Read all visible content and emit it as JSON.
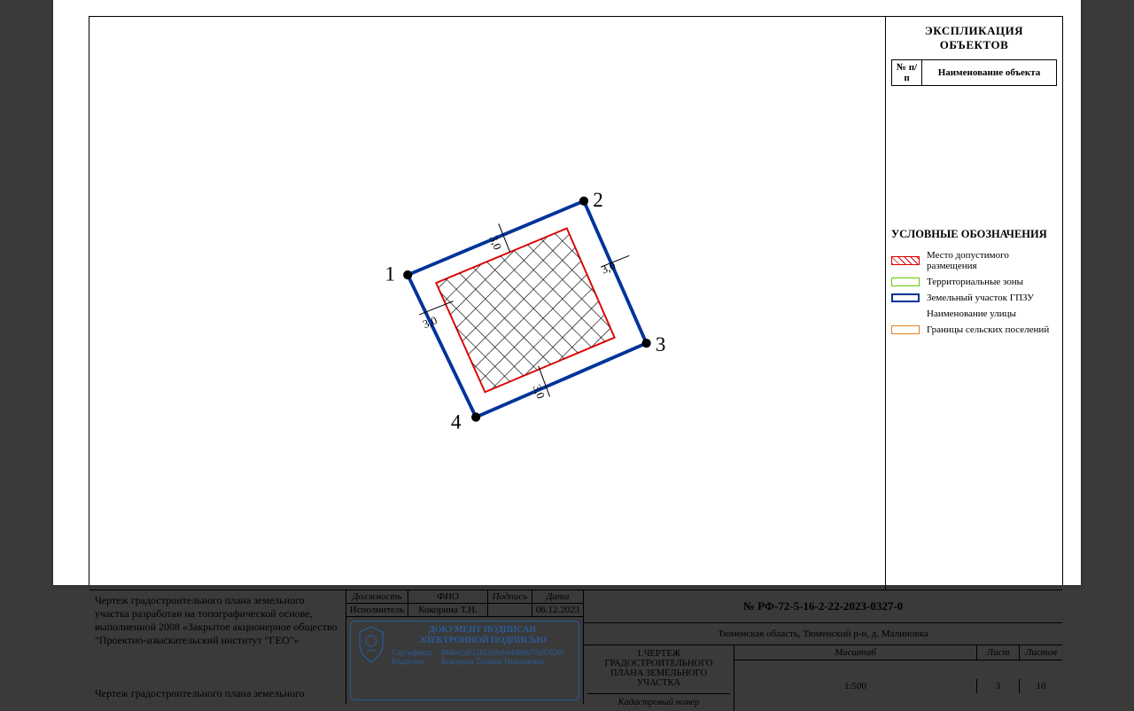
{
  "explication": {
    "title": "ЭКСПЛИКАЦИЯ ОБЪЕКТОВ",
    "h1": "№ п/п",
    "h2": "Наименование объекта"
  },
  "legend": {
    "title": "УСЛОВНЫЕ ОБОЗНАЧЕНИЯ",
    "items": [
      "Место допустимого размещения",
      "Территориальные зоны",
      "Земельный участок ГПЗУ",
      "Наименование улицы",
      "Границы сельских поселений"
    ]
  },
  "drawing": {
    "points": [
      "1",
      "2",
      "3",
      "4"
    ],
    "offset": "3,0"
  },
  "note": {
    "para1": "Чертеж градостроительного плана земельного участка разработан  на топографической основе, выполненной 2008 «Закрытое акционерное общество \"Проектно-изыскательский институт \"ГЕО\"»",
    "para2": "Чертеж градостроительного плана земельного"
  },
  "sign": {
    "h_role": "Должность",
    "h_name": "ФИО",
    "h_sign": "Подпись",
    "h_date": "Дата",
    "role": "Исполнитель",
    "name": "Кокорина Т.Н.",
    "date": "06.12.2023"
  },
  "stamp": {
    "title1": "ДОКУМЕНТ ПОДПИСАН",
    "title2": "ЭЛЕКТРОННОЙ ПОДПИСЬЮ",
    "l_cert": "Сертификат",
    "cert": "844ee2a022bf5b8eb646b6b79a97626f",
    "l_owner": "Владелец",
    "owner": "Кокорина Татьяна Николаевна"
  },
  "title": {
    "num": "№ РФ-72-5-16-2-22-2023-0327-0",
    "addr": "Тюменская область, Тюменский р-н, д. Малиновка",
    "dtitle": "1.ЧЕРТЕЖ ГРАДОСТРОИТЕЛЬНОГО ПЛАНА ЗЕМЕЛЬНОГО УЧАСТКА",
    "kad": "Кадастровый номер",
    "h_scale": "Масштаб",
    "h_sheet": "Лист",
    "h_sheets": "Листов",
    "scale": "1:500",
    "sheet": "3",
    "sheets": "10"
  }
}
